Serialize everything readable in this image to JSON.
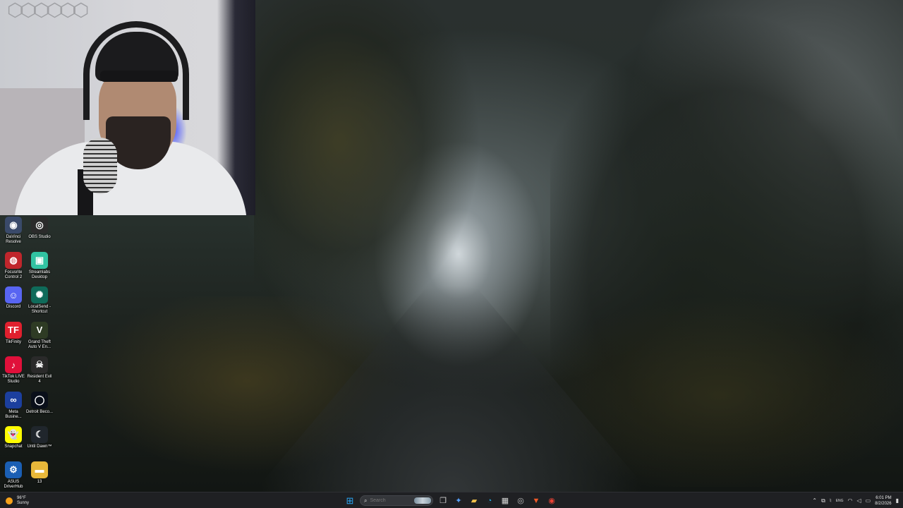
{
  "desktop": {
    "icons": [
      {
        "label": "DaVinci Resolve",
        "icon": "davinci-resolve-icon",
        "color": "#3a4a6a",
        "glyph": "◉"
      },
      {
        "label": "OBS Studio",
        "icon": "obs-studio-icon",
        "color": "#2b2b2b",
        "glyph": "◎"
      },
      {
        "label": "Focusrite Control 2",
        "icon": "focusrite-icon",
        "color": "#c0262c",
        "glyph": "◍"
      },
      {
        "label": "Streamlabs Desktop",
        "icon": "streamlabs-icon",
        "color": "#31c3a2",
        "glyph": "▣"
      },
      {
        "label": "Discord",
        "icon": "discord-icon",
        "color": "#5865f2",
        "glyph": "☺"
      },
      {
        "label": "LocalSend - Shortcut",
        "icon": "localsend-icon",
        "color": "#0f6b5a",
        "glyph": "✺"
      },
      {
        "label": "TikFinity",
        "icon": "tikfinity-icon",
        "color": "#e0202e",
        "glyph": "TF"
      },
      {
        "label": "Grand Theft Auto V En...",
        "icon": "gta-v-icon",
        "color": "#2e3b24",
        "glyph": "V"
      },
      {
        "label": "TikTok LIVE Studio",
        "icon": "tiktok-live-icon",
        "color": "#e0103a",
        "glyph": "♪"
      },
      {
        "label": "Resident Evil 4",
        "icon": "resident-evil-icon",
        "color": "#2a2a2a",
        "glyph": "☠"
      },
      {
        "label": "Meta Busine...",
        "icon": "meta-business-icon",
        "color": "#1c3f9e",
        "glyph": "∞"
      },
      {
        "label": "Detroit Beco...",
        "icon": "detroit-icon",
        "color": "#0a0f1a",
        "glyph": "◯"
      },
      {
        "label": "Snapchat",
        "icon": "snapchat-icon",
        "color": "#fffc00",
        "glyph": "👻"
      },
      {
        "label": "Until Dawn™",
        "icon": "until-dawn-icon",
        "color": "#20262c",
        "glyph": "☾"
      },
      {
        "label": "ASUS DriverHub",
        "icon": "asus-driverhub-icon",
        "color": "#1b5fb4",
        "glyph": "⚙"
      },
      {
        "label": "13",
        "icon": "folder-icon",
        "color": "#e8b83a",
        "glyph": "▬"
      }
    ]
  },
  "taskbar": {
    "weather": {
      "temp": "96°F",
      "condition": "Sunny"
    },
    "search_placeholder": "Search",
    "apps": [
      {
        "name": "start",
        "icon": "windows-start-icon",
        "glyph": "⊞",
        "color": "#2aa6f5"
      },
      {
        "name": "task-view",
        "icon": "task-view-icon",
        "glyph": "❐",
        "color": "#d0d0d0"
      },
      {
        "name": "copilot",
        "icon": "copilot-icon",
        "glyph": "✦",
        "color": "#59a3ff"
      },
      {
        "name": "file-explorer",
        "icon": "file-explorer-icon",
        "glyph": "▰",
        "color": "#f2c14b"
      },
      {
        "name": "edge",
        "icon": "edge-browser-icon",
        "glyph": "◔",
        "color": "#23a8e0"
      },
      {
        "name": "microsoft-store",
        "icon": "store-icon",
        "glyph": "▦",
        "color": "#d8d8d8"
      },
      {
        "name": "obs",
        "icon": "obs-taskbar-icon",
        "glyph": "◎",
        "color": "#bcbcbc"
      },
      {
        "name": "brave",
        "icon": "brave-browser-icon",
        "glyph": "▼",
        "color": "#f25a29"
      },
      {
        "name": "chrome",
        "icon": "chrome-browser-icon",
        "glyph": "◉",
        "color": "#e94235"
      }
    ],
    "tray": {
      "time": "6:01 PM",
      "date": "8/2/2026",
      "language": "ENG"
    }
  }
}
